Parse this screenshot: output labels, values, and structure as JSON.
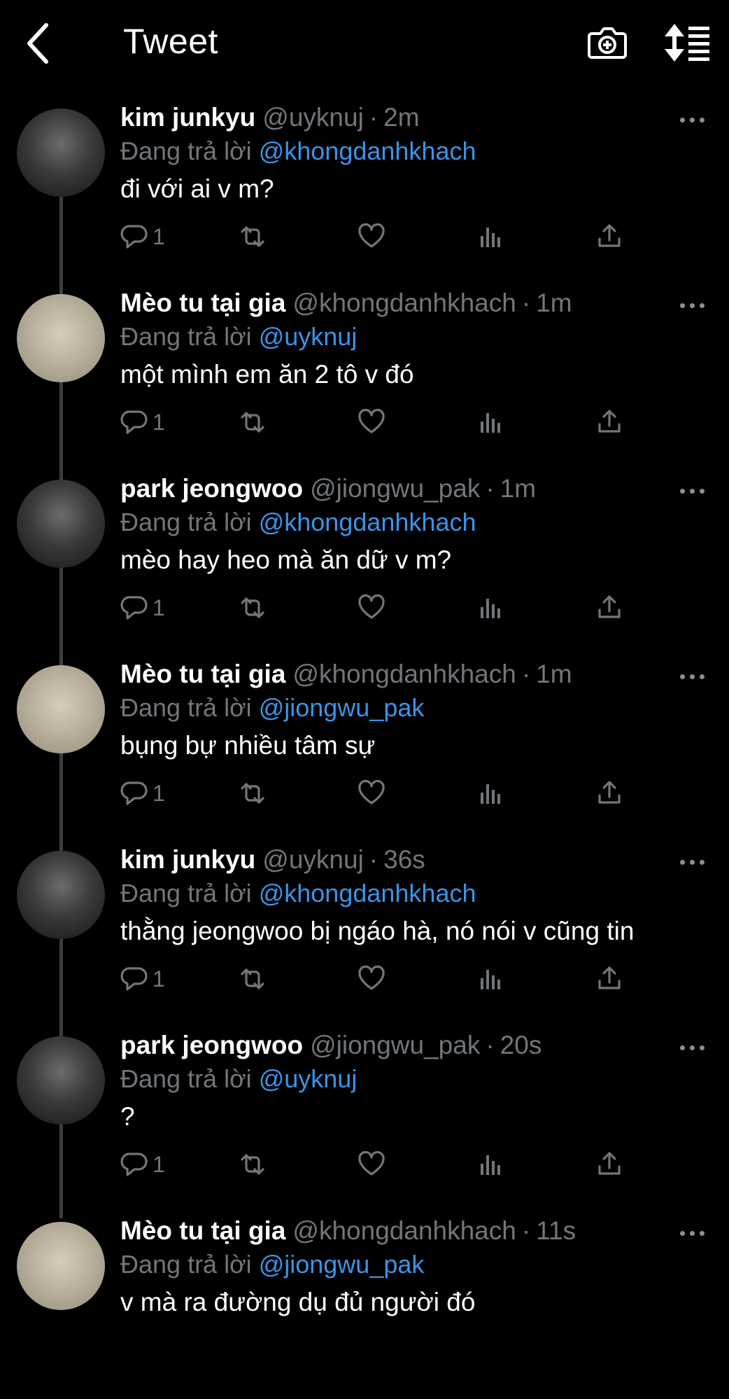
{
  "header": {
    "title": "Tweet",
    "back_icon": "chevron-left-icon",
    "camera_icon": "camera-plus-icon",
    "sort_icon": "sort-list-icon"
  },
  "colors": {
    "background": "#000000",
    "text": "#ffffff",
    "muted": "#71767b",
    "link": "#3b93e6",
    "thread_line": "#3a3d41"
  },
  "tweets": [
    {
      "name": "kim junkyu",
      "handle": "@uyknuj",
      "time": "2m",
      "reply_prefix": "Đang trả lời",
      "reply_to": "@khongdanhkhach",
      "text": "đi với ai v m?",
      "reply_count": "1"
    },
    {
      "name": "Mèo tu tại gia",
      "handle": "@khongdanhkhach",
      "time": "1m",
      "reply_prefix": "Đang trả lời",
      "reply_to": "@uyknuj",
      "text": "một mình em ăn 2 tô v đó",
      "reply_count": "1"
    },
    {
      "name": "park jeongwoo",
      "handle": "@jiongwu_pak",
      "time": "1m",
      "reply_prefix": "Đang trả lời",
      "reply_to": "@khongdanhkhach",
      "text": "mèo hay heo mà ăn dữ v m?",
      "reply_count": "1"
    },
    {
      "name": "Mèo tu tại gia",
      "handle": "@khongdanhkhach",
      "time": "1m",
      "reply_prefix": "Đang trả lời",
      "reply_to": "@jiongwu_pak",
      "text": "bụng bự nhiều tâm sự",
      "reply_count": "1"
    },
    {
      "name": "kim junkyu",
      "handle": "@uyknuj",
      "time": "36s",
      "reply_prefix": "Đang trả lời",
      "reply_to": "@khongdanhkhach",
      "text": "thằng jeongwoo bị ngáo hà, nó nói v cũng tin",
      "reply_count": "1"
    },
    {
      "name": "park jeongwoo",
      "handle": "@jiongwu_pak",
      "time": "20s",
      "reply_prefix": "Đang trả lời",
      "reply_to": "@uyknuj",
      "text": "?",
      "reply_count": "1"
    },
    {
      "name": "Mèo tu tại gia",
      "handle": "@khongdanhkhach",
      "time": "11s",
      "reply_prefix": "Đang trả lời",
      "reply_to": "@jiongwu_pak",
      "text": "v mà ra đường dụ đủ người đó",
      "reply_count": ""
    }
  ]
}
